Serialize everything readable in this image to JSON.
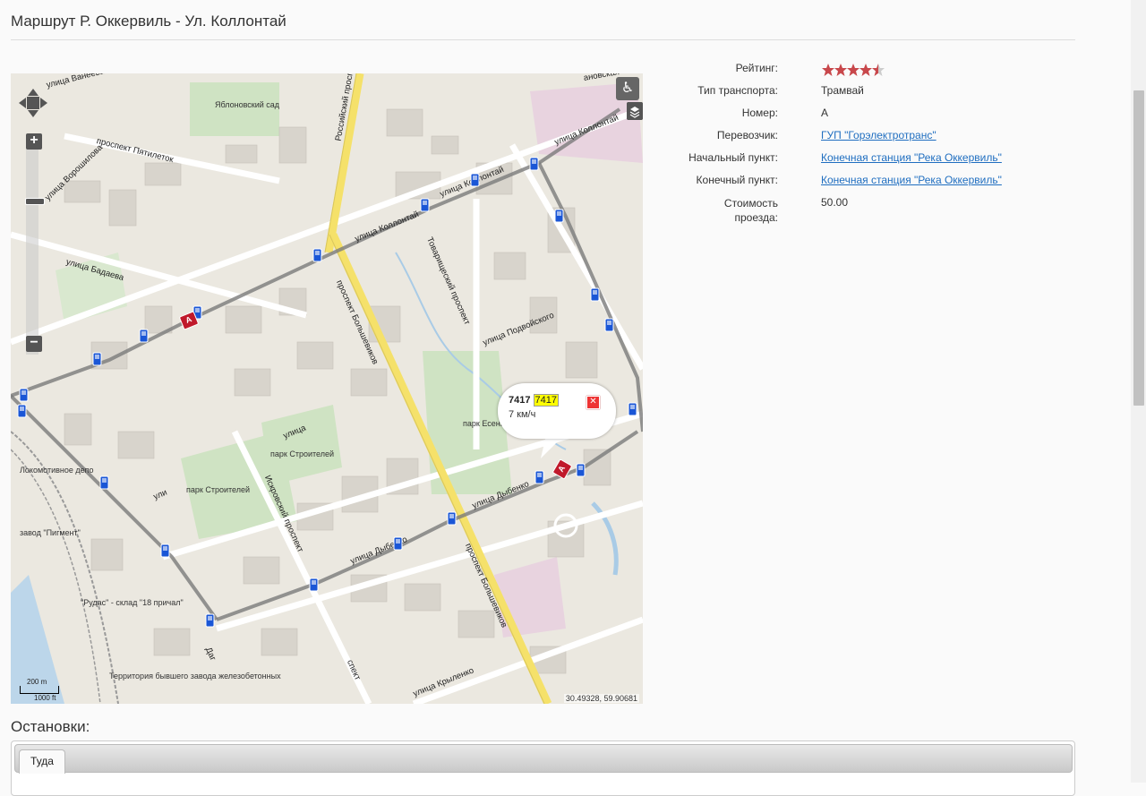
{
  "page": {
    "title": "Маршрут Р. Оккервиль - Ул. Коллонтай",
    "stops_title": "Остановки:"
  },
  "map": {
    "labels": {
      "garden": "Яблоновский сад",
      "park_esenin": "парк Есенина",
      "park_builders_1": "парк Строителей",
      "park_builders_2": "парк Строителей",
      "depot": "Локомотивное депо",
      "pigment": "завод \"Пигмент\"",
      "rudas": "\"Рудас\" - склад \"18 причал\"",
      "territory": "Территория бывшего завода железобетонных"
    },
    "streets": {
      "vaneeva": "улица Ванеева",
      "kollontai_1": "улица Коллонтай",
      "kollontai_2": "улица Коллонтай",
      "kollontai_3": "улица Коллонтай",
      "badaeva_1": "улица Бадаева",
      "badaeva_2": "улица Дыбенко",
      "russian": "Российский проспект",
      "bolshevikov_1": "проспект Большевиков",
      "bolshevikov_2": "проспект Большевиков",
      "tovarish": "Товарищеский проспект",
      "podvoiskogo": "улица Подвойского",
      "iskrovsky": "Искровский проспект",
      "voroshilova": "улица Ворошилова",
      "pyatiletok": "проспект Пятилеток",
      "krylenko": "улица Крыленко",
      "dybenko": "улица Дыбенко",
      "ul": "ули",
      "ulitsa": "улица",
      "prospect": "спект",
      "dag": "Даг",
      "ivanovskaya": "ановская"
    },
    "popup": {
      "id": "7417",
      "id_highlight": "7417",
      "speed": "7 км/ч"
    },
    "tram_route_label": "A",
    "scale_m": "200 m",
    "scale_ft": "1000 ft",
    "coords": "30.49328, 59.90681"
  },
  "info": {
    "rating": {
      "label": "Рейтинг:",
      "value": 4.5,
      "max": 5
    },
    "type": {
      "label": "Тип транспорта:",
      "value": "Трамвай"
    },
    "number": {
      "label": "Номер:",
      "value": "А"
    },
    "carrier": {
      "label": "Перевозчик:",
      "value": "ГУП \"Горэлектротранс\""
    },
    "start": {
      "label": "Начальный пункт:",
      "value": "Конечная станция \"Река Оккервиль\""
    },
    "end": {
      "label": "Конечный пункт:",
      "value": "Конечная станция \"Река Оккервиль\""
    },
    "price": {
      "label": "Стоимость проезда:",
      "value": "50.00"
    }
  },
  "tabs": [
    {
      "label": "Туда"
    }
  ],
  "colors": {
    "link": "#1f6ec0",
    "star": "#c8474b",
    "route": "#c0192b",
    "stop": "#1a56d6"
  }
}
